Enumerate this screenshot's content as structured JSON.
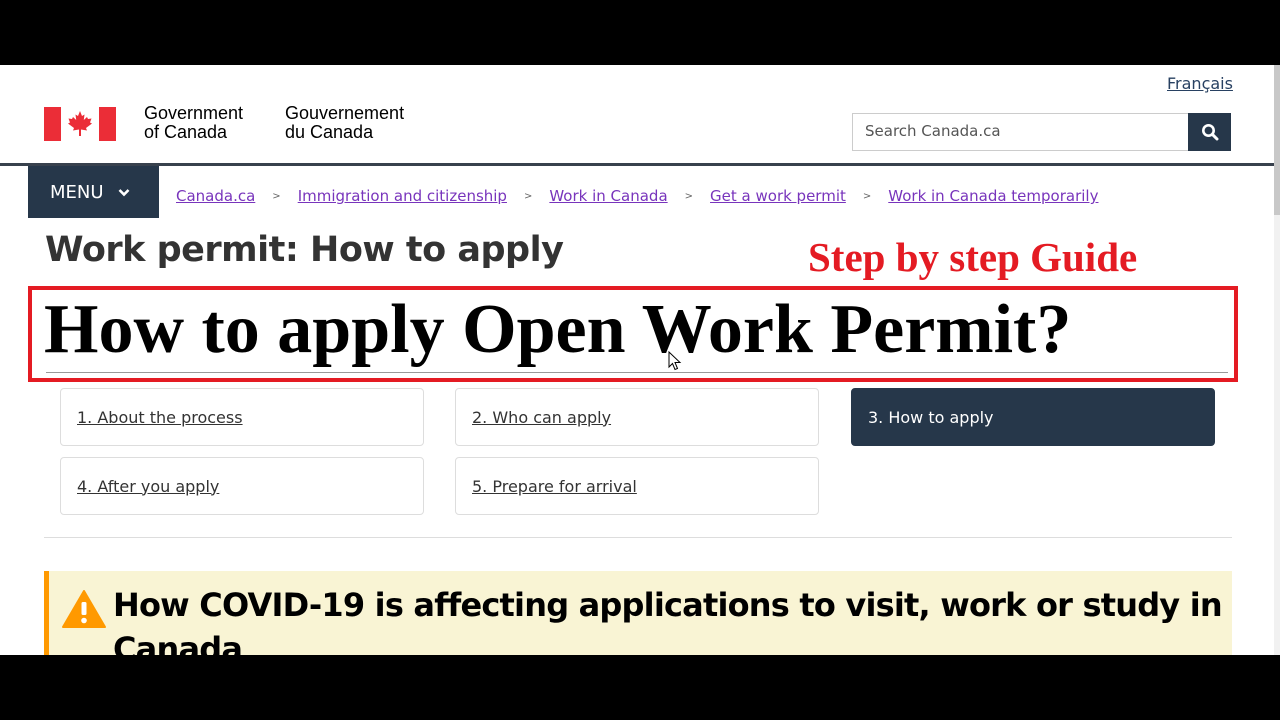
{
  "header": {
    "language_link": "Français",
    "gov_name_en": [
      "Government",
      "of Canada"
    ],
    "gov_name_fr": [
      "Gouvernement",
      "du Canada"
    ],
    "search": {
      "placeholder": "Search Canada.ca",
      "value": ""
    }
  },
  "nav": {
    "menu_label": "MENU",
    "breadcrumbs": [
      {
        "label": "Canada.ca"
      },
      {
        "label": "Immigration and citizenship"
      },
      {
        "label": "Work in Canada"
      },
      {
        "label": "Get a work permit"
      },
      {
        "label": "Work in Canada temporarily"
      }
    ]
  },
  "main": {
    "page_title": "Work permit: How to apply",
    "overlay": {
      "subtitle": "Step by step Guide",
      "title": "How to apply Open Work Permit?",
      "subtitle_color": "#e41b23",
      "border_color": "#e41b23"
    },
    "steps": [
      {
        "label": "1. About the process",
        "active": false
      },
      {
        "label": "2. Who can apply",
        "active": false
      },
      {
        "label": "3. How to apply",
        "active": true
      },
      {
        "label": "4. After you apply",
        "active": false
      },
      {
        "label": "5. Prepare for arrival",
        "active": false
      }
    ],
    "alert": {
      "icon": "warning-icon",
      "heading": "How COVID-19 is affecting applications to visit, work or study in Canada"
    }
  },
  "colors": {
    "brand_dark": "#26374a",
    "flag_red": "#eb2d37",
    "link_visited": "#7834bc",
    "alert_bg": "#f9f4d4",
    "alert_border": "#ff9900"
  }
}
